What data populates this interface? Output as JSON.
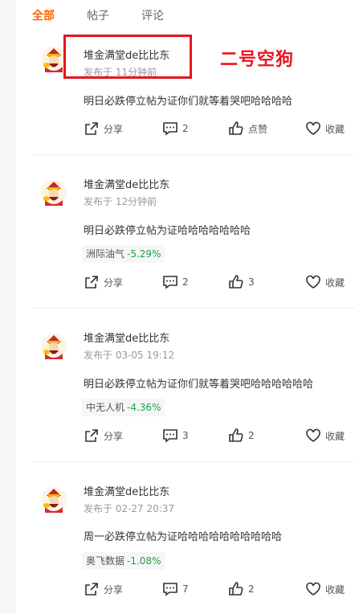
{
  "tabs": [
    {
      "label": "全部",
      "active": true
    },
    {
      "label": "帖子",
      "active": false
    },
    {
      "label": "评论",
      "active": false
    }
  ],
  "annotation": {
    "text": "二号空狗",
    "color": "#e8151c"
  },
  "colors": {
    "accent": "#ff6600",
    "stock_down": "#1aa34a"
  },
  "posts": [
    {
      "author": "堆金满堂de比比东",
      "time": "发布于 11分钟前",
      "content": "明日必跌停立帖为证你们就等着哭吧哈哈哈哈",
      "stock": null,
      "actions": {
        "share": "分享",
        "comments": "2",
        "like": "点赞",
        "favorite": "收藏"
      }
    },
    {
      "author": "堆金满堂de比比东",
      "time": "发布于 12分钟前",
      "content": "明日必跌停立帖为证哈哈哈哈哈哈哈",
      "stock": {
        "name": "洲际油气",
        "change": "-5.29%"
      },
      "actions": {
        "share": "分享",
        "comments": "2",
        "like": "3",
        "favorite": "收藏"
      }
    },
    {
      "author": "堆金满堂de比比东",
      "time": "发布于 03-05 19:12",
      "content": "明日必跌停立帖为证你们就等着哭吧哈哈哈哈哈哈",
      "stock": {
        "name": "中无人机",
        "change": "-4.36%"
      },
      "actions": {
        "share": "分享",
        "comments": "3",
        "like": "2",
        "favorite": "收藏"
      }
    },
    {
      "author": "堆金满堂de比比东",
      "time": "发布于 02-27 20:37",
      "content": "周一必跌停立帖为证哈哈哈哈哈哈哈哈哈哈",
      "stock": {
        "name": "奥飞数据",
        "change": "-1.08%"
      },
      "actions": {
        "share": "分享",
        "comments": "7",
        "like": "2",
        "favorite": "收藏"
      }
    }
  ]
}
